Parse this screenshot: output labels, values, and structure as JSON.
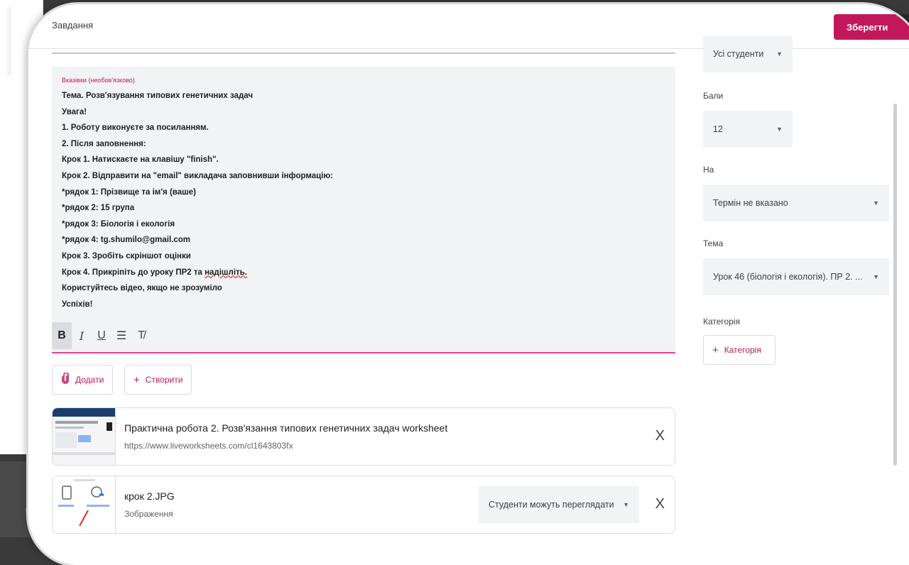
{
  "topbar": {
    "title": "Завдання",
    "save_label": "Зберегти"
  },
  "description": {
    "label": "Вказівки (необов'язково)",
    "lines": [
      "Тема. Розв'язування типових генетичних задач",
      "Увага!",
      "1. Роботу виконуєте за посиланням.",
      "2. Після заповнення:",
      "Крок 1. Натискаєте на клавішу \"finish\".",
      "Крок 2. Відправити на \"email\" викладача заповнивши інформацію:",
      "*рядок 1: Прізвище та ім'я (ваше)",
      "*рядок 2: 15 група",
      "*рядок 3: Біологія і екологія",
      "*рядок 4: tg.shumilo@gmail.com",
      "Крок 3. Зробіть скріншот оцінки",
      "Крок 4. Прикріпіть до уроку ПР2 та ",
      "Користуйтесь відео, якщо не зрозуміло",
      "Успіхів!"
    ],
    "line12_underlined": "надішліть.",
    "format": {
      "bold": "B",
      "italic": "I",
      "underline": "U",
      "list": "☰",
      "clear": "T̸"
    }
  },
  "actions": {
    "add_label": "Додати",
    "create_label": "Створити"
  },
  "attachments": [
    {
      "title": "Практична робота 2. Розв'язання типових генетичних задач worksheet",
      "subtitle": "https://www.liveworksheets.com/cl1643803fx"
    },
    {
      "title": "крок 2.JPG",
      "subtitle": "Зображення",
      "permission": "Студенти можуть переглядати"
    }
  ],
  "right_panel": {
    "students": "Усі студенти",
    "points_label": "Бали",
    "points_value": "12",
    "due_label": "На",
    "due_value": "Термін не вказано",
    "topic_label": "Тема",
    "topic_value": "Урок 46 (біологія і екологія). ПР 2. ...",
    "category_label": "Категорія",
    "category_button": "Категорія"
  },
  "colors": {
    "accent": "#c2185b",
    "field_bg": "#f1f3f4"
  },
  "icons": {
    "close": "X",
    "plus": "+",
    "clip": "paperclip-icon",
    "caret": "▼"
  }
}
